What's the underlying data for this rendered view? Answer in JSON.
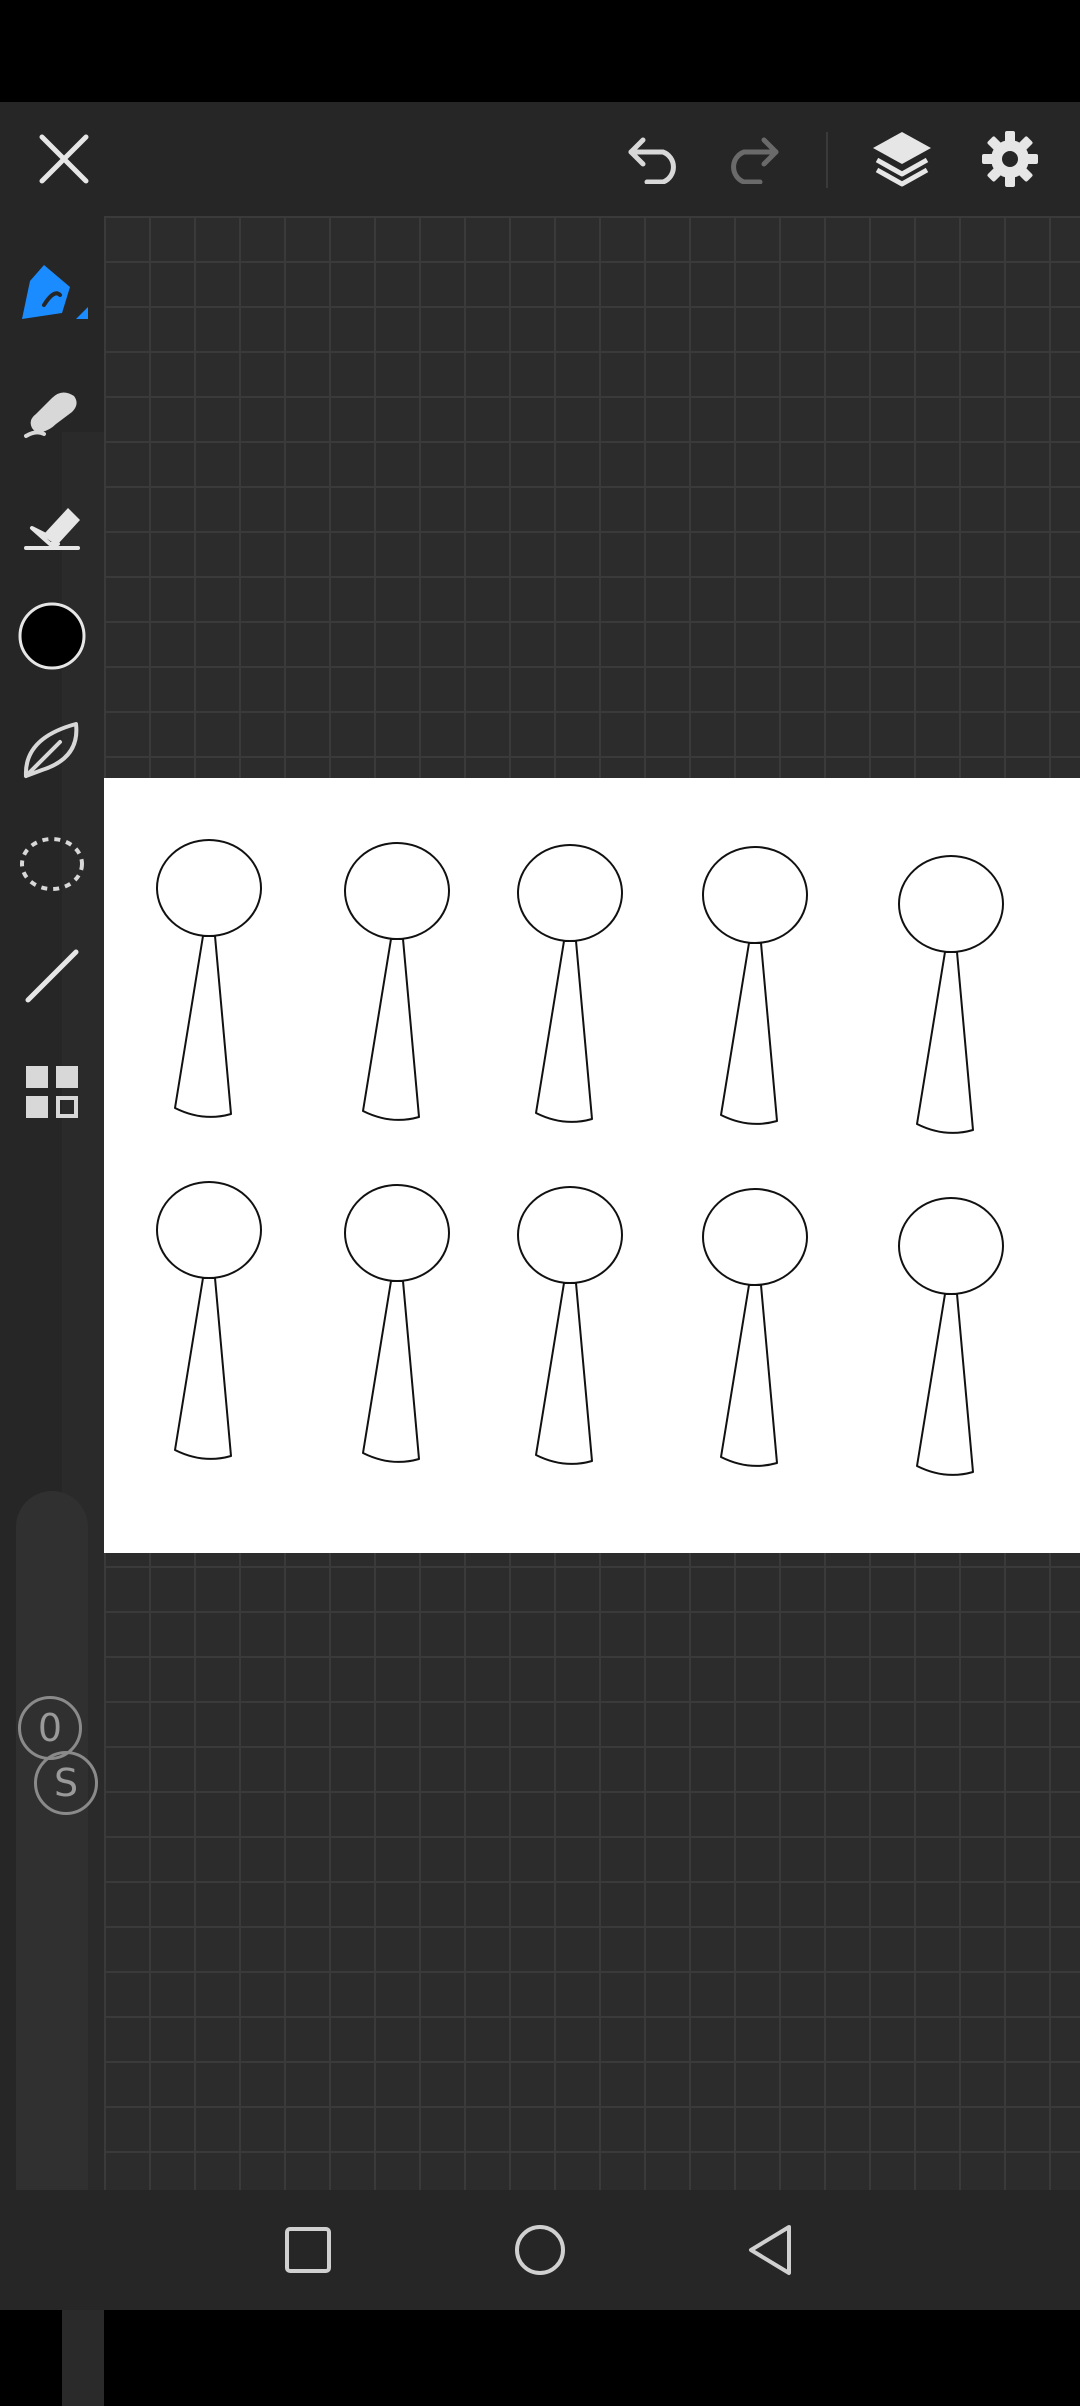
{
  "colors": {
    "accent": "#1a8cff",
    "toolbar_bg": "#262626",
    "canvas_bg": "#2c2c2c",
    "paper": "#ffffff",
    "current_color": "#000000"
  },
  "top_toolbar": {
    "icons": [
      "close-icon",
      "undo-icon",
      "redo-icon",
      "layers-icon",
      "settings-icon"
    ]
  },
  "left_toolbar": {
    "tools": [
      "pen-tool-icon",
      "smudge-tool-icon",
      "eraser-icon",
      "color-swatch",
      "shape-fill-icon",
      "lasso-select-icon",
      "line-tool-icon",
      "more-tools-icon"
    ],
    "size_button_label": "S",
    "opacity_button_label": "0"
  },
  "canvas": {
    "figure_count": 10,
    "figure_rows": 2,
    "figure_columns": 5
  },
  "nav_bar": {
    "icons": [
      "recents-icon",
      "home-icon",
      "back-icon"
    ]
  }
}
